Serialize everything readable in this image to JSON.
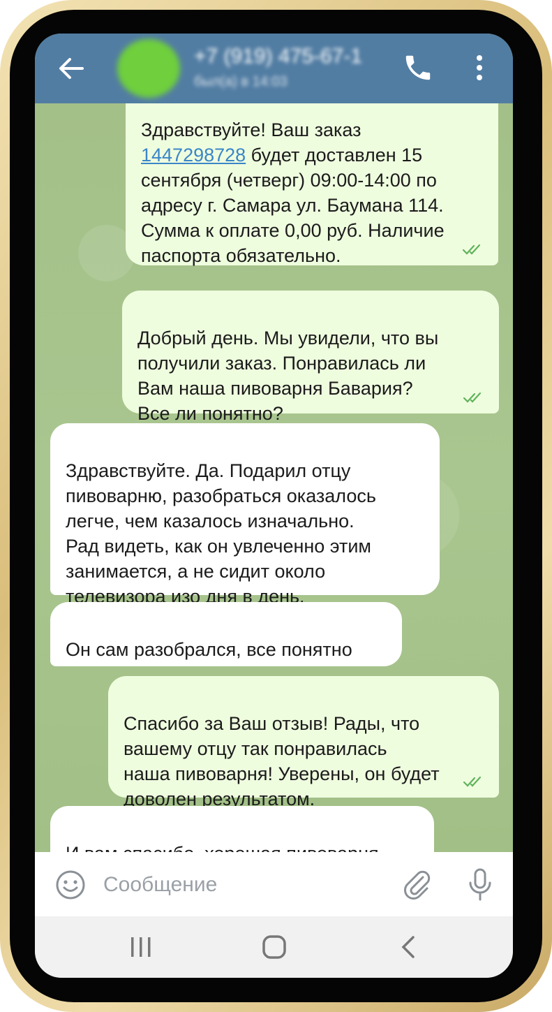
{
  "header": {
    "contact_name": "+7 (919) 475-67-1",
    "contact_status": "был(а) в 14:03"
  },
  "messages": [
    {
      "direction": "outgoing",
      "text_top": "Здравствуйте! Ваш заказ",
      "link": "1447298728",
      "text_after_link": " будет доставлен 15\nсентября (четверг) 09:00-14:00 по\nадресу г. Самара ул. Баумана 114.\nСумма к оплате 0,00 руб. Наличие\nпаспорта обязательно.",
      "status": "read"
    },
    {
      "direction": "outgoing",
      "text": "Добрый день. Мы увидели, что вы\nполучили заказ.  Понравилась ли\nВам наша пивоварня Бавария?\n Все ли понятно?",
      "status": "read"
    },
    {
      "direction": "incoming",
      "text": "Здравствуйте. Да. Подарил отцу\nпивоварню, разобраться оказалось\nлегче, чем казалось изначально.\nРад видеть, как он увлеченно этим\nзанимается, а не сидит около\nтелевизора изо дня в день."
    },
    {
      "direction": "incoming",
      "text": "Он сам разобрался, все понятно"
    },
    {
      "direction": "outgoing",
      "text": "Спасибо за Ваш отзыв! Рады, что\nвашему отцу так понравилась\nнаша пивоварня! Уверены, он будет\nдоволен результатом.",
      "status": "read"
    },
    {
      "direction": "incoming",
      "text": "И вам спасибо, хорошая пивоварня",
      "emoji": "👍"
    }
  ],
  "input": {
    "placeholder": "Сообщение"
  },
  "colors": {
    "header": "#527da3",
    "outgoing_bubble": "#effddf",
    "incoming_bubble": "#ffffff",
    "read_ticks": "#5fb35a",
    "link": "#3a86c8"
  },
  "icons": [
    "back-arrow-icon",
    "phone-icon",
    "more-vert-icon",
    "emoji-icon",
    "attach-icon",
    "mic-icon",
    "recents-icon",
    "home-icon",
    "nav-back-icon"
  ]
}
